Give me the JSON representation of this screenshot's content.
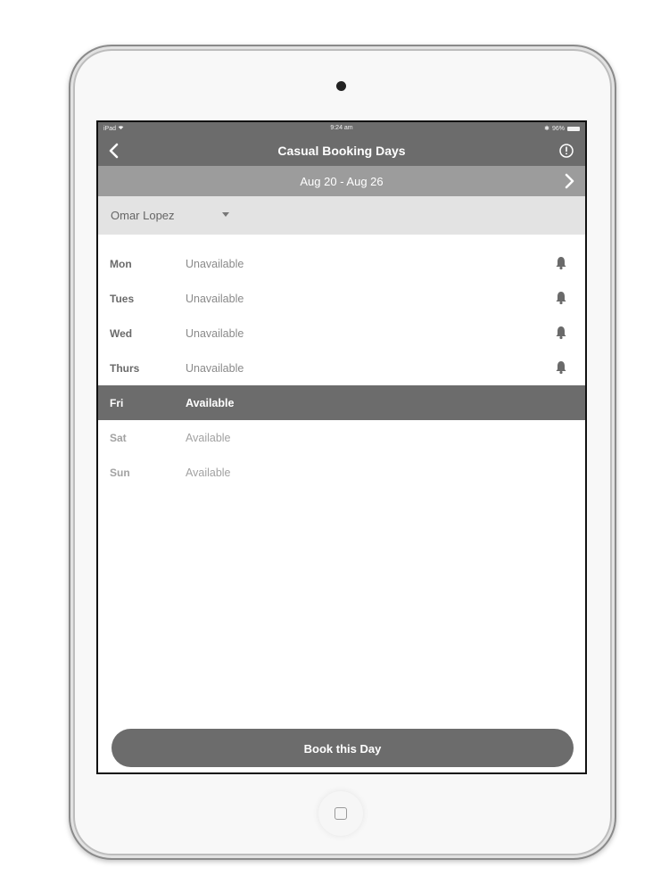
{
  "status_bar": {
    "device": "iPad",
    "time": "9:24 am",
    "battery": "96%"
  },
  "nav": {
    "title": "Casual Booking Days",
    "back_icon": "chevron-left-icon",
    "info_icon": "info-circle-icon"
  },
  "week": {
    "range": "Aug 20 - Aug 26",
    "next_icon": "chevron-right-icon"
  },
  "person": {
    "name": "Omar Lopez",
    "dropdown_icon": "caret-down-icon"
  },
  "days": [
    {
      "day": "Mon",
      "status": "Unavailable",
      "bell": true
    },
    {
      "day": "Tues",
      "status": "Unavailable",
      "bell": true
    },
    {
      "day": "Wed",
      "status": "Unavailable",
      "bell": true
    },
    {
      "day": "Thurs",
      "status": "Unavailable",
      "bell": true
    },
    {
      "day": "Fri",
      "status": "Available",
      "selected": true
    },
    {
      "day": "Sat",
      "status": "Available"
    },
    {
      "day": "Sun",
      "status": "Available"
    }
  ],
  "actions": {
    "book_label": "Book this Day"
  },
  "colors": {
    "header": "#6c6c6c",
    "week_bar": "#9c9c9c",
    "person_bar": "#e3e3e3",
    "selected_row": "#6c6c6c"
  }
}
